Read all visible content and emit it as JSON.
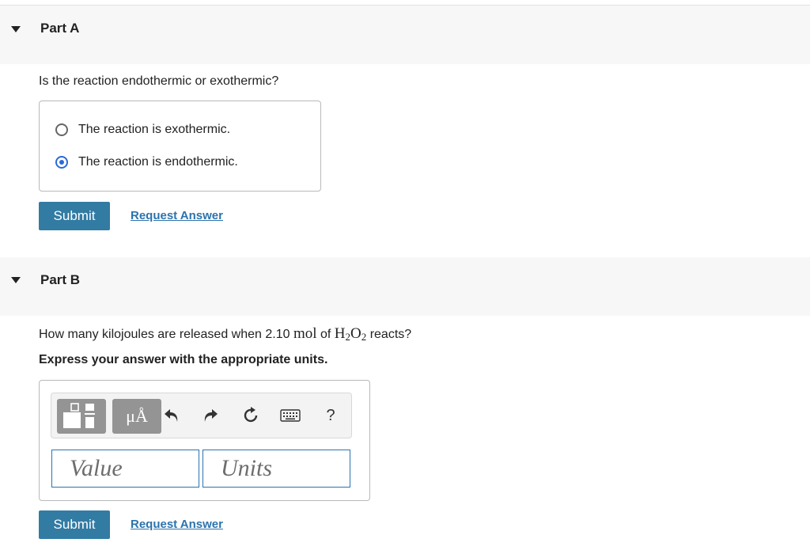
{
  "part_a": {
    "title": "Part A",
    "question": "Is the reaction endothermic or exothermic?",
    "options": [
      {
        "label": "The reaction is exothermic.",
        "selected": false
      },
      {
        "label": "The reaction is endothermic.",
        "selected": true
      }
    ],
    "submit_label": "Submit",
    "request_answer_label": "Request Answer"
  },
  "part_b": {
    "title": "Part B",
    "question": {
      "before": "How many kilojoules are released when 2.10",
      "unit": "mol",
      "of": "of",
      "formula": [
        "H",
        "2",
        "O",
        "2"
      ],
      "after": "reacts?"
    },
    "instruction": "Express your answer with the appropriate units.",
    "toolbar": {
      "template_icon": "fraction-template-icon",
      "units_label": "μÅ",
      "undo_icon": "undo-icon",
      "redo_icon": "redo-icon",
      "reset_icon": "reset-icon",
      "keyboard_icon": "keyboard-icon",
      "help_label": "?"
    },
    "value_placeholder": "Value",
    "units_placeholder": "Units",
    "submit_label": "Submit",
    "request_answer_label": "Request Answer"
  },
  "colors": {
    "accent": "#327ba3",
    "link": "#2c73ad",
    "radio_selected": "#2a6ad8",
    "header_bg": "#f7f7f7"
  }
}
